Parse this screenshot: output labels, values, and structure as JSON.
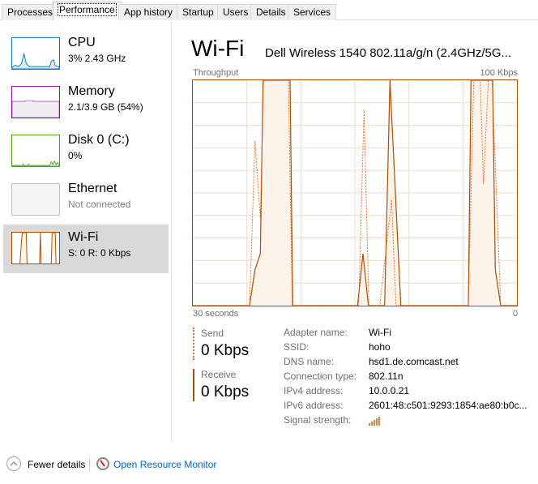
{
  "tabs": [
    "Processes",
    "Performance",
    "App history",
    "Startup",
    "Users",
    "Details",
    "Services"
  ],
  "active_tab": "Performance",
  "sidebar": [
    {
      "name": "CPU",
      "sub": "3% 2.43 GHz",
      "color": "#117dbb"
    },
    {
      "name": "Memory",
      "sub": "2.1/3.9 GB (54%)",
      "color": "#8b12ae"
    },
    {
      "name": "Disk 0 (C:)",
      "sub": "0%",
      "color": "#4da60c"
    },
    {
      "name": "Ethernet",
      "sub": "Not connected",
      "color": "#c0c0c0"
    },
    {
      "name": "Wi-Fi",
      "sub": "S: 0 R: 0 Kbps",
      "color": "#a74f01"
    }
  ],
  "main": {
    "title": "Wi-Fi",
    "adapter": "Dell Wireless 1540 802.11a/g/n (2.4GHz/5G...",
    "throughput_label": "Throughput",
    "max_label": "100 Kbps",
    "x_left": "30 seconds",
    "x_right": "0",
    "send_label": "Send",
    "send_value": "0 Kbps",
    "receive_label": "Receive",
    "receive_value": "0 Kbps",
    "properties": [
      {
        "k": "Adapter name:",
        "v": "Wi-Fi"
      },
      {
        "k": "SSID:",
        "v": "hoho"
      },
      {
        "k": "DNS name:",
        "v": "hsd1.de.comcast.net"
      },
      {
        "k": "Connection type:",
        "v": "802.11n"
      },
      {
        "k": "IPv4 address:",
        "v": "10.0.0.21"
      },
      {
        "k": "IPv6 address:",
        "v": "2601:48:c501:9293:1854:ae80:b0c..."
      },
      {
        "k": "Signal strength:",
        "v": ""
      }
    ],
    "signal_bars": 5
  },
  "chart_data": {
    "type": "line",
    "ylabel": "Throughput",
    "xlim": [
      30,
      0
    ],
    "ylim": [
      0,
      100
    ],
    "y_unit": "Kbps",
    "grid": true,
    "series": [
      {
        "name": "Receive",
        "style": "solid",
        "color": "#a74f01",
        "fill": "#fcf3eb",
        "points": [
          [
            30,
            0
          ],
          [
            24.75,
            0
          ],
          [
            24.25,
            16
          ],
          [
            23.75,
            23
          ],
          [
            23.5,
            100
          ],
          [
            21,
            100
          ],
          [
            20.75,
            0
          ],
          [
            14.75,
            0
          ],
          [
            14.25,
            23
          ],
          [
            13.75,
            0
          ],
          [
            12.25,
            0
          ],
          [
            11.75,
            100
          ],
          [
            10.75,
            0
          ],
          [
            4.5,
            0
          ],
          [
            4.25,
            100
          ],
          [
            2.25,
            100
          ],
          [
            2,
            16
          ],
          [
            1.5,
            0
          ],
          [
            0,
            0
          ]
        ]
      },
      {
        "name": "Send",
        "style": "dashed",
        "color": "#e06a2c",
        "points": [
          [
            30,
            0
          ],
          [
            24.75,
            0
          ],
          [
            24.25,
            73
          ],
          [
            23.75,
            39
          ],
          [
            23.45,
            100
          ],
          [
            21.15,
            100
          ],
          [
            20.8,
            0
          ],
          [
            14.65,
            0
          ],
          [
            14.15,
            87
          ],
          [
            13.7,
            0
          ],
          [
            12.7,
            0
          ],
          [
            11.6,
            47
          ],
          [
            11.2,
            0
          ],
          [
            4.5,
            0
          ],
          [
            4,
            100
          ],
          [
            3.4,
            100
          ],
          [
            3.1,
            54
          ],
          [
            2.65,
            100
          ],
          [
            2.3,
            100
          ],
          [
            1.5,
            0
          ],
          [
            0,
            0
          ]
        ]
      }
    ]
  },
  "footer": {
    "fewer": "Fewer details",
    "monitor": "Open Resource Monitor",
    "link_color": "#0066cc"
  }
}
